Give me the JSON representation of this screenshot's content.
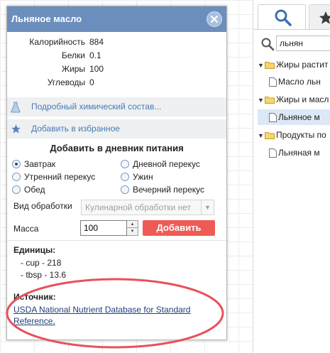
{
  "popup": {
    "title": "Льняное масло",
    "nutrients": [
      {
        "key": "Калорийность",
        "value": "884"
      },
      {
        "key": "Белки",
        "value": "0.1"
      },
      {
        "key": "Жиры",
        "value": "100"
      },
      {
        "key": "Углеводы",
        "value": "0"
      }
    ],
    "chem_link": "Подробный химический состав...",
    "favorite_link": "Добавить в избранное",
    "diary_title": "Добавить в дневник питания",
    "meals": {
      "breakfast": "Завтрак",
      "day_snack": "Дневной перекус",
      "morning_snack": "Утренний перекус",
      "dinner": "Ужин",
      "lunch": "Обед",
      "evening_snack": "Вечерний перекус"
    },
    "selected_meal": "Завтрак",
    "processing_label": "Вид обработки",
    "processing_value": "Кулинарной обработки нет",
    "mass_label": "Масса",
    "mass_value": "100",
    "add_button": "Добавить",
    "units_title": "Единицы:",
    "units": [
      "- cup - 218",
      "- tbsp - 13.6"
    ],
    "source_title": "Источник:",
    "source_link": "USDA National Nutrient Database for Standard Reference",
    "source_tail": "."
  },
  "right_panel": {
    "search_value": "льнян",
    "tree": [
      {
        "label": "Жиры растит",
        "type": "folder"
      },
      {
        "label": "Масло льн",
        "type": "file"
      },
      {
        "label": "Жиры и масл",
        "type": "folder"
      },
      {
        "label": "Льняное м",
        "type": "file"
      },
      {
        "label": "Продукты по",
        "type": "folder"
      },
      {
        "label": "Льняная м",
        "type": "file"
      }
    ]
  },
  "colors": {
    "header": "#6b8ebd",
    "link": "#4a79b6",
    "add_button": "#f05a55",
    "annotation": "#e8505b"
  }
}
